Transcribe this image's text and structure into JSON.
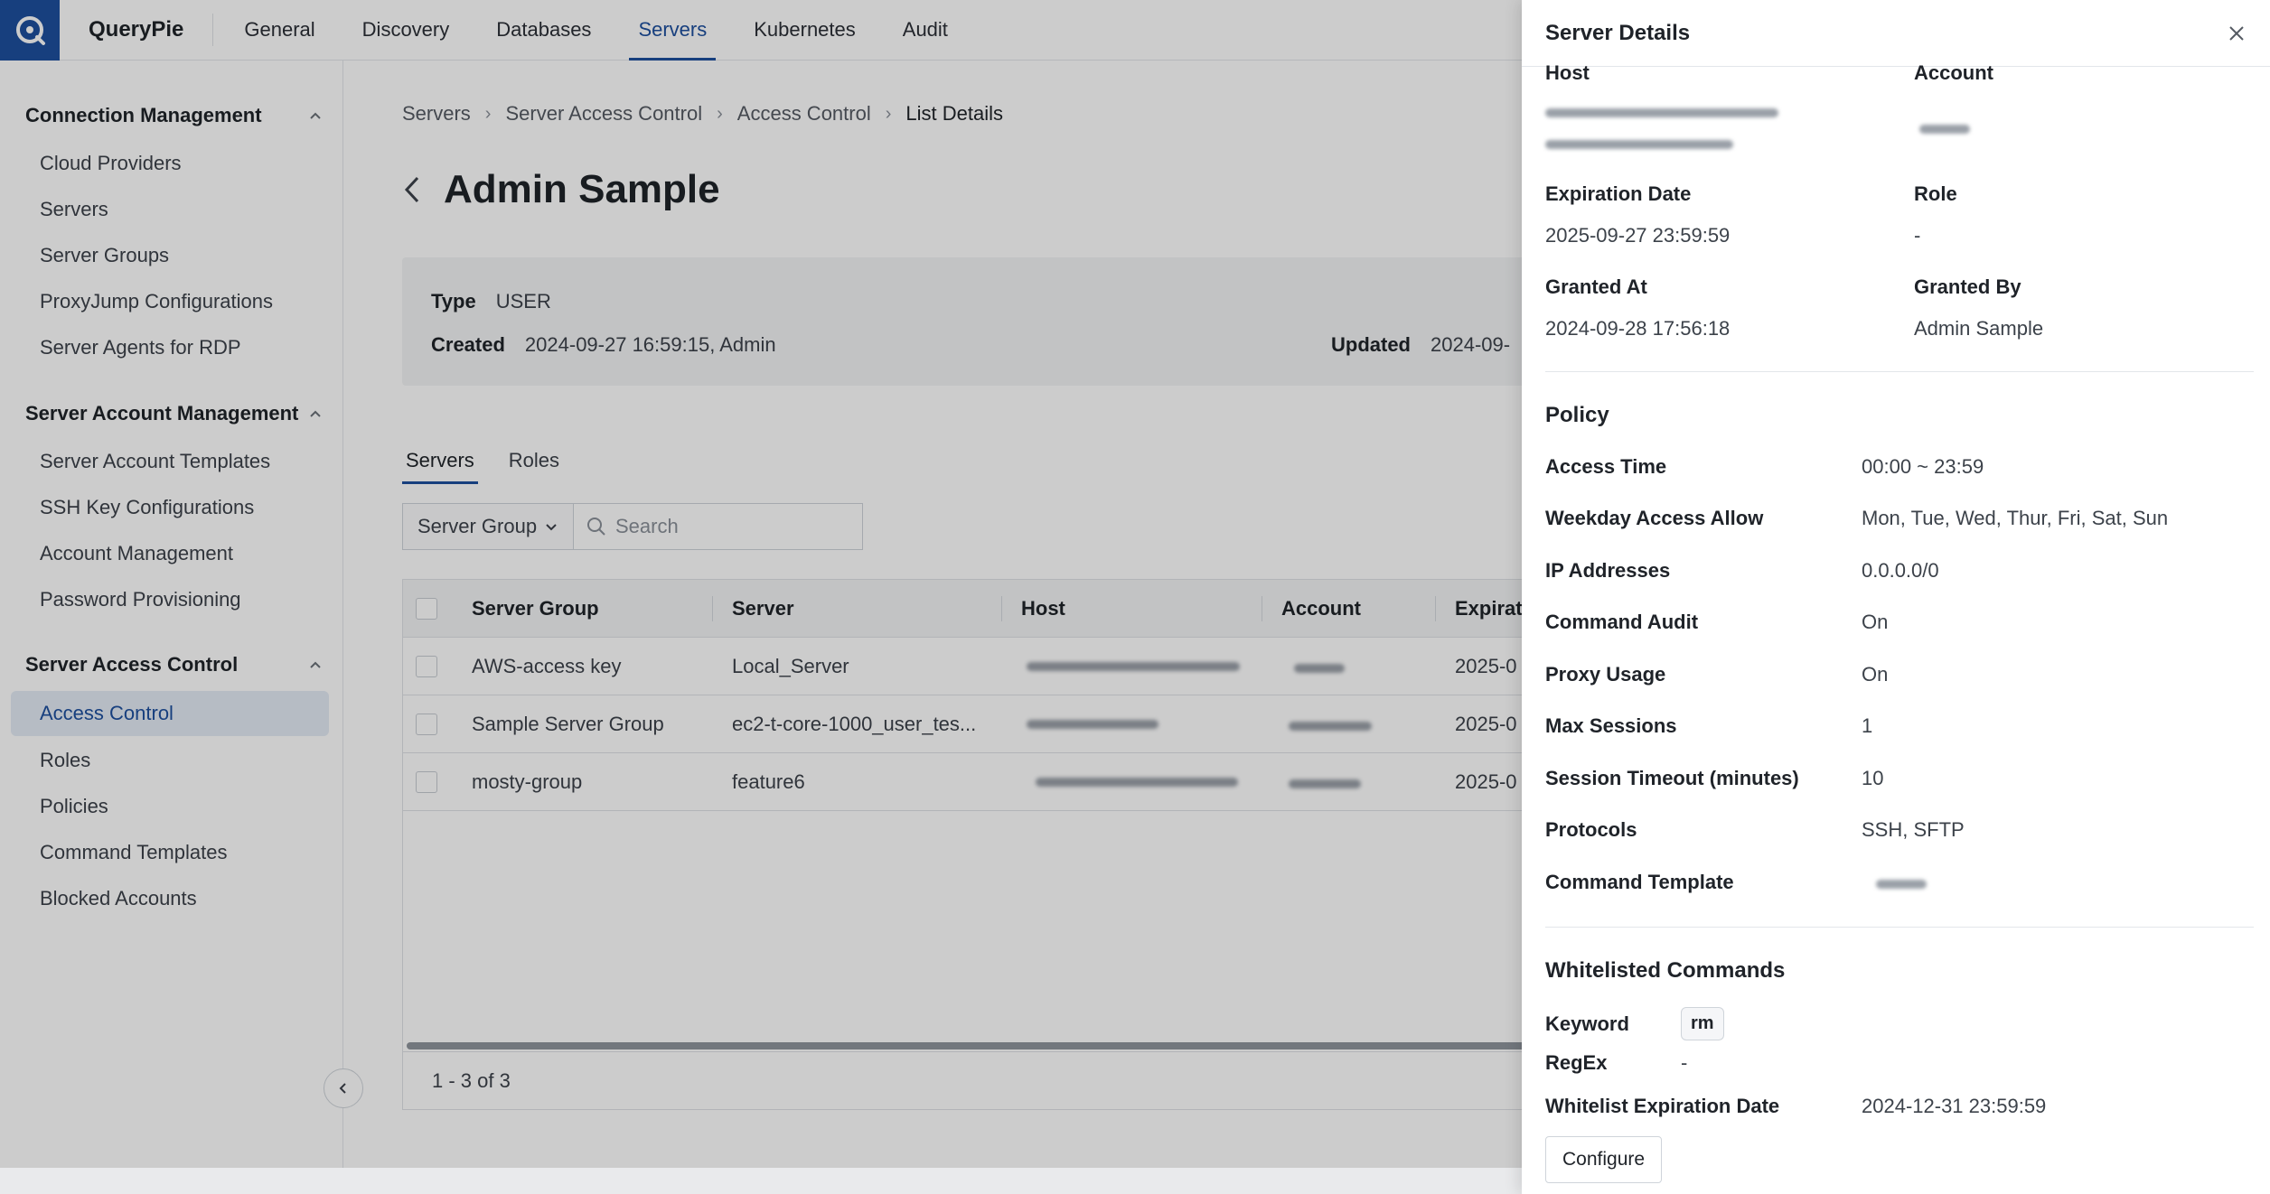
{
  "app": {
    "brand": "QueryPie"
  },
  "topnav": {
    "items": [
      "General",
      "Discovery",
      "Databases",
      "Servers",
      "Kubernetes",
      "Audit"
    ],
    "active": "Servers"
  },
  "sidebar": {
    "sections": [
      {
        "title": "Connection Management",
        "items": [
          "Cloud Providers",
          "Servers",
          "Server Groups",
          "ProxyJump Configurations",
          "Server Agents for RDP"
        ]
      },
      {
        "title": "Server Account Management",
        "items": [
          "Server Account Templates",
          "SSH Key Configurations",
          "Account Management",
          "Password Provisioning"
        ]
      },
      {
        "title": "Server Access Control",
        "items": [
          "Access Control",
          "Roles",
          "Policies",
          "Command Templates",
          "Blocked Accounts"
        ]
      }
    ],
    "active_item": "Access Control"
  },
  "breadcrumb": [
    "Servers",
    "Server Access Control",
    "Access Control",
    "List Details"
  ],
  "page": {
    "title": "Admin Sample",
    "type_label": "Type",
    "type_value": "USER",
    "created_label": "Created",
    "created_value": "2024-09-27 16:59:15, Admin",
    "updated_label": "Updated",
    "updated_value": "2024-09-"
  },
  "tabs": [
    "Servers",
    "Roles"
  ],
  "filter": {
    "select_value": "Server Group",
    "search_placeholder": "Search"
  },
  "table": {
    "columns": [
      "Server Group",
      "Server",
      "Host",
      "Account",
      "Expiratio"
    ],
    "rows": [
      {
        "server_group": "AWS-access key",
        "server": "Local_Server",
        "expiration": "2025-0"
      },
      {
        "server_group": "Sample Server Group",
        "server": "ec2-t-core-1000_user_tes...",
        "expiration": "2025-0"
      },
      {
        "server_group": "mosty-group",
        "server": "feature6",
        "expiration": "2025-0"
      }
    ],
    "footer": "1 - 3 of 3"
  },
  "drawer": {
    "title": "Server Details",
    "host_label": "Host",
    "account_label": "Account",
    "expiration_label": "Expiration Date",
    "expiration_value": "2025-09-27 23:59:59",
    "role_label": "Role",
    "role_value": "-",
    "granted_at_label": "Granted At",
    "granted_at_value": "2024-09-28 17:56:18",
    "granted_by_label": "Granted By",
    "granted_by_value": "Admin Sample",
    "policy_title": "Policy",
    "policy": [
      {
        "label": "Access Time",
        "value": "00:00 ~ 23:59"
      },
      {
        "label": "Weekday Access Allow",
        "value": "Mon, Tue, Wed, Thur, Fri, Sat, Sun"
      },
      {
        "label": "IP Addresses",
        "value": "0.0.0.0/0"
      },
      {
        "label": "Command Audit",
        "value": "On"
      },
      {
        "label": "Proxy Usage",
        "value": "On"
      },
      {
        "label": "Max Sessions",
        "value": "1"
      },
      {
        "label": "Session Timeout (minutes)",
        "value": "10"
      },
      {
        "label": "Protocols",
        "value": "SSH, SFTP"
      },
      {
        "label": "Command Template",
        "value": ""
      }
    ],
    "whitelist_title": "Whitelisted Commands",
    "keyword_label": "Keyword",
    "keyword_value": "rm",
    "regex_label": "RegEx",
    "regex_value": "-",
    "whitelist_exp_label": "Whitelist Expiration Date",
    "whitelist_exp_value": "2024-12-31 23:59:59",
    "configure_label": "Configure"
  }
}
